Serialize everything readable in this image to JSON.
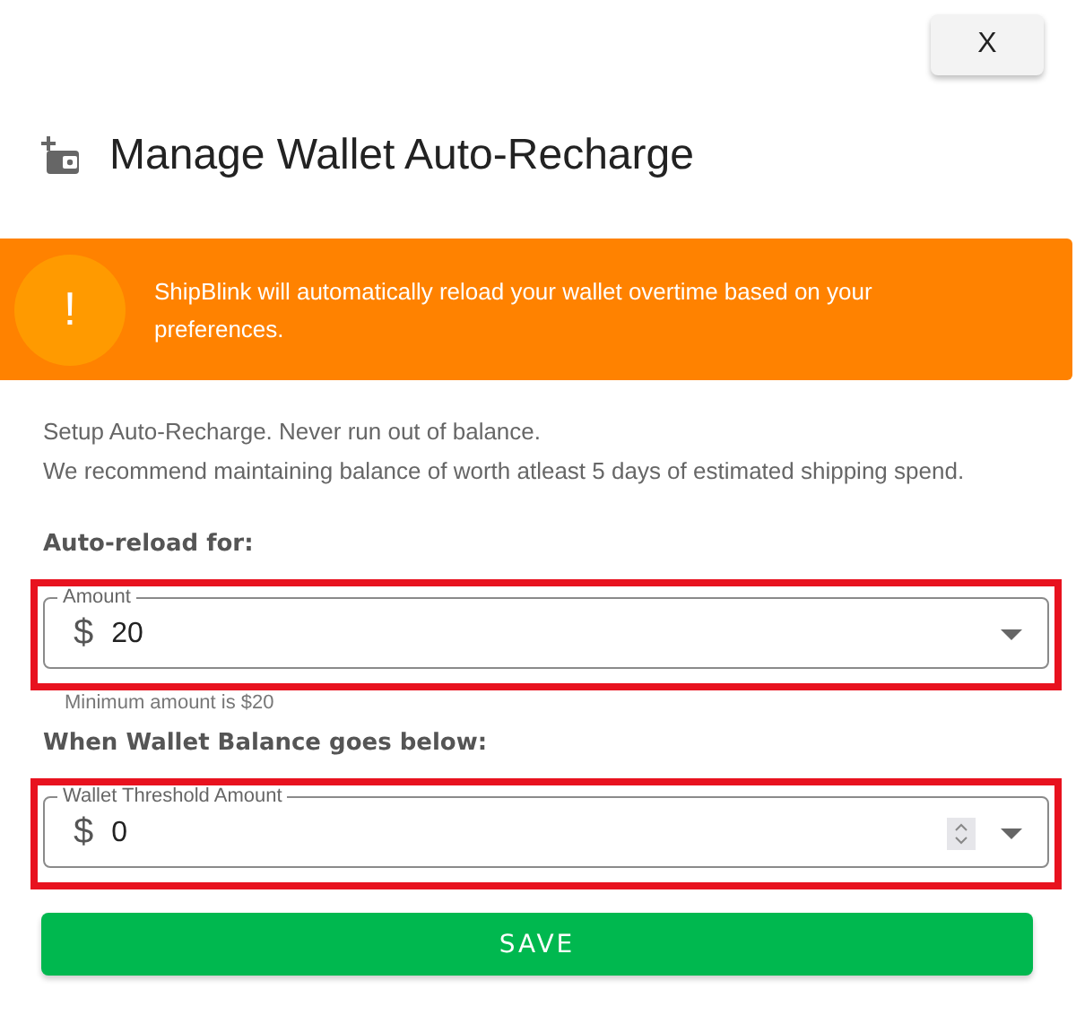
{
  "close_button": {
    "label": "X"
  },
  "title": "Manage Wallet Auto-Recharge",
  "alert": {
    "icon": "!",
    "message": "ShipBlink will automatically reload your wallet overtime based on your preferences."
  },
  "intro": [
    "Setup Auto-Recharge. Never run out of balance.",
    "We recommend maintaining balance of worth atleast 5 days of estimated shipping spend."
  ],
  "sections": [
    {
      "heading": "Auto-reload for:",
      "field": {
        "kind": "select",
        "label": "Amount",
        "prefix": "$",
        "value": "20",
        "helper": "Minimum amount is $20"
      }
    },
    {
      "heading": "When Wallet Balance goes below:",
      "field": {
        "kind": "number",
        "label": "Wallet Threshold Amount",
        "prefix": "$",
        "value": "0"
      }
    }
  ],
  "save_button": {
    "label": "SAVE"
  }
}
